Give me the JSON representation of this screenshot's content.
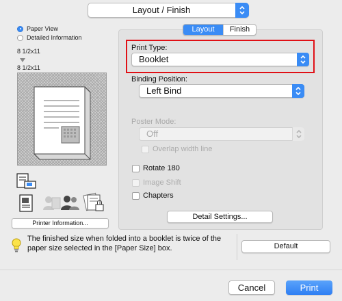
{
  "header": {
    "panel_select": "Layout / Finish"
  },
  "left": {
    "view_options": [
      {
        "label": "Paper View",
        "selected": true
      },
      {
        "label": "Detailed Information",
        "selected": false
      }
    ],
    "original_size": "8 1/2x11",
    "output_size": "8 1/2x11",
    "printer_info_button": "Printer Information..."
  },
  "tabs": [
    {
      "label": "Layout",
      "active": true
    },
    {
      "label": "Finish",
      "active": false
    }
  ],
  "print_type": {
    "label": "Print Type:",
    "value": "Booklet"
  },
  "binding_position": {
    "label": "Binding Position:",
    "value": "Left Bind"
  },
  "poster_mode": {
    "label": "Poster Mode:",
    "value": "Off",
    "enabled": false
  },
  "checkboxes": {
    "overlap": {
      "label": "Overlap width line",
      "checked": false,
      "enabled": false
    },
    "rotate": {
      "label": "Rotate 180",
      "checked": false,
      "enabled": true
    },
    "image_shift": {
      "label": "Image Shift",
      "checked": false,
      "enabled": false
    },
    "chapters": {
      "label": "Chapters",
      "checked": false,
      "enabled": true
    }
  },
  "detail_settings_button": "Detail Settings...",
  "hint": "The finished size when folded into a booklet is twice of the paper size selected in the [Paper Size] box.",
  "default_button": "Default",
  "footer": {
    "cancel": "Cancel",
    "print": "Print"
  },
  "colors": {
    "accent": "#3a8cf5",
    "highlight_box": "#e01016"
  },
  "icons": [
    "chevron-updown-icon",
    "booklet-preview-icon",
    "printer-settings-icon",
    "document-icon",
    "users-icon",
    "lock-document-icon",
    "lightbulb-icon"
  ]
}
